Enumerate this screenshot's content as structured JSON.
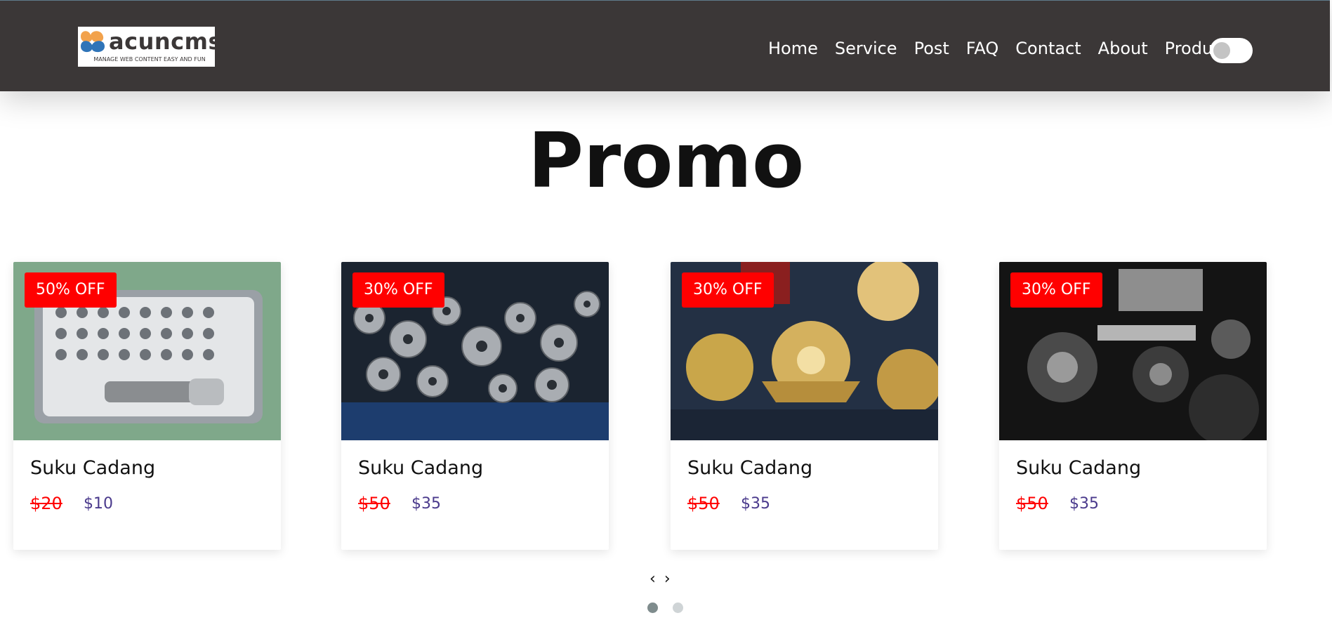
{
  "header": {
    "logo": {
      "word": "acuncms",
      "tagline": "MANAGE WEB CONTENT EASY AND FUN"
    },
    "nav": [
      "Home",
      "Service",
      "Post",
      "FAQ",
      "Contact",
      "About",
      "Product"
    ],
    "theme_toggle": {
      "state": "off"
    }
  },
  "main": {
    "title": "Promo",
    "cards": [
      {
        "badge": "50% OFF",
        "title": "Suku Cadang",
        "old_price": "$20",
        "new_price": "$10"
      },
      {
        "badge": "30% OFF",
        "title": "Suku Cadang",
        "old_price": "$50",
        "new_price": "$35"
      },
      {
        "badge": "30% OFF",
        "title": "Suku Cadang",
        "old_price": "$50",
        "new_price": "$35"
      },
      {
        "badge": "30% OFF",
        "title": "Suku Cadang",
        "old_price": "$50",
        "new_price": "$35"
      }
    ],
    "carousel": {
      "prev": "‹",
      "next": "›",
      "pages": 2,
      "active_page": 1
    }
  },
  "colors": {
    "navbar_bg": "#3b3737",
    "badge_bg": "#ff0000",
    "old_price": "#ff0000",
    "new_price": "#4a3a8c",
    "dot_active": "#7f8c8d",
    "dot_inactive": "#cfd4d6"
  }
}
